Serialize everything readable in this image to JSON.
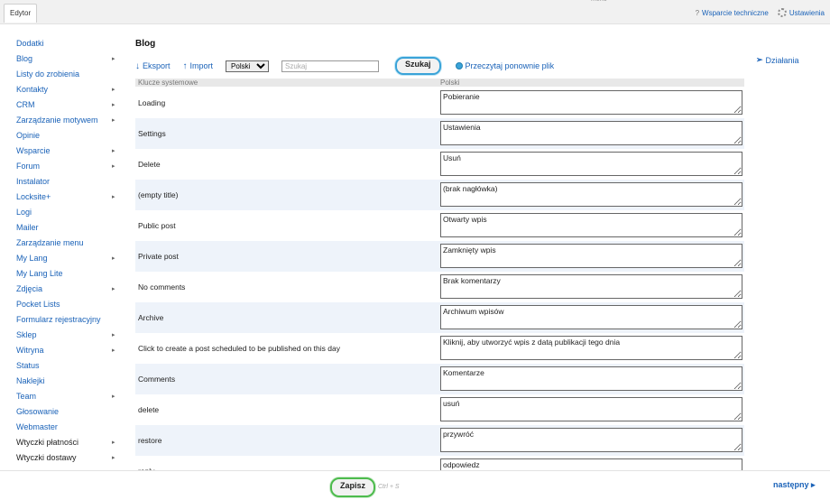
{
  "topbar": {
    "tab_label": "Edytor",
    "menu_label": "menu",
    "support_label": "Wsparcie techniczne",
    "settings_label": "Ustawienia",
    "help_icon": "?"
  },
  "sidebar": {
    "items": [
      {
        "label": "Dodatki",
        "arrow": false,
        "dark": false
      },
      {
        "label": "Blog",
        "arrow": true,
        "dark": false
      },
      {
        "label": "Listy do zrobienia",
        "arrow": false,
        "dark": false
      },
      {
        "label": "Kontakty",
        "arrow": true,
        "dark": false
      },
      {
        "label": "CRM",
        "arrow": true,
        "dark": false
      },
      {
        "label": "Zarządzanie motywem",
        "arrow": true,
        "dark": false
      },
      {
        "label": "Opinie",
        "arrow": false,
        "dark": false
      },
      {
        "label": "Wsparcie",
        "arrow": true,
        "dark": false
      },
      {
        "label": "Forum",
        "arrow": true,
        "dark": false
      },
      {
        "label": "Instalator",
        "arrow": false,
        "dark": false
      },
      {
        "label": "Locksite+",
        "arrow": true,
        "dark": false
      },
      {
        "label": "Logi",
        "arrow": false,
        "dark": false
      },
      {
        "label": "Mailer",
        "arrow": false,
        "dark": false
      },
      {
        "label": "Zarządzanie menu",
        "arrow": false,
        "dark": false
      },
      {
        "label": "My Lang",
        "arrow": true,
        "dark": false
      },
      {
        "label": "My Lang Lite",
        "arrow": false,
        "dark": false
      },
      {
        "label": "Zdjęcia",
        "arrow": true,
        "dark": false
      },
      {
        "label": "Pocket Lists",
        "arrow": false,
        "dark": false
      },
      {
        "label": "Formularz rejestracyjny",
        "arrow": false,
        "dark": false
      },
      {
        "label": "Sklep",
        "arrow": true,
        "dark": false
      },
      {
        "label": "Witryna",
        "arrow": true,
        "dark": false
      },
      {
        "label": "Status",
        "arrow": false,
        "dark": false
      },
      {
        "label": "Naklejki",
        "arrow": false,
        "dark": false
      },
      {
        "label": "Team",
        "arrow": true,
        "dark": false
      },
      {
        "label": "Głosowanie",
        "arrow": false,
        "dark": false
      },
      {
        "label": "Webmaster",
        "arrow": false,
        "dark": false
      },
      {
        "label": "Wtyczki płatności",
        "arrow": true,
        "dark": true
      },
      {
        "label": "Wtyczki dostawy",
        "arrow": true,
        "dark": true
      }
    ]
  },
  "main": {
    "title": "Blog",
    "toolbar": {
      "export_label": "Eksport",
      "import_label": "Import",
      "language_selected": "Polski",
      "search_placeholder": "Szukaj",
      "search_button": "Szukaj",
      "reload_label": "Przeczytaj ponownie plik"
    },
    "table": {
      "col_keys": "Klucze systemowe",
      "col_lang": "Polski",
      "rows": [
        {
          "key": "Loading",
          "value": "Pobieranie"
        },
        {
          "key": "Settings",
          "value": "Ustawienia"
        },
        {
          "key": "Delete",
          "value": "Usuń"
        },
        {
          "key": "(empty title)",
          "value": "(brak nagłówka)"
        },
        {
          "key": "Public post",
          "value": "Otwarty wpis"
        },
        {
          "key": "Private post",
          "value": "Zamknięty wpis"
        },
        {
          "key": "No comments",
          "value": "Brak komentarzy"
        },
        {
          "key": "Archive",
          "value": "Archiwum wpisów"
        },
        {
          "key": "Click to create a post scheduled to be published on this day",
          "value": "Kliknij, aby utworzyć wpis z datą publikacji tego dnia"
        },
        {
          "key": "Comments",
          "value": "Komentarze"
        },
        {
          "key": "delete",
          "value": "usuń"
        },
        {
          "key": "restore",
          "value": "przywróć"
        },
        {
          "key": "reply",
          "value": "odpowiedz"
        }
      ]
    }
  },
  "actions_label": "Działania",
  "bottombar": {
    "save_label": "Zapisz",
    "shortcut": "Ctrl + S",
    "next_label": "następny ▸"
  }
}
